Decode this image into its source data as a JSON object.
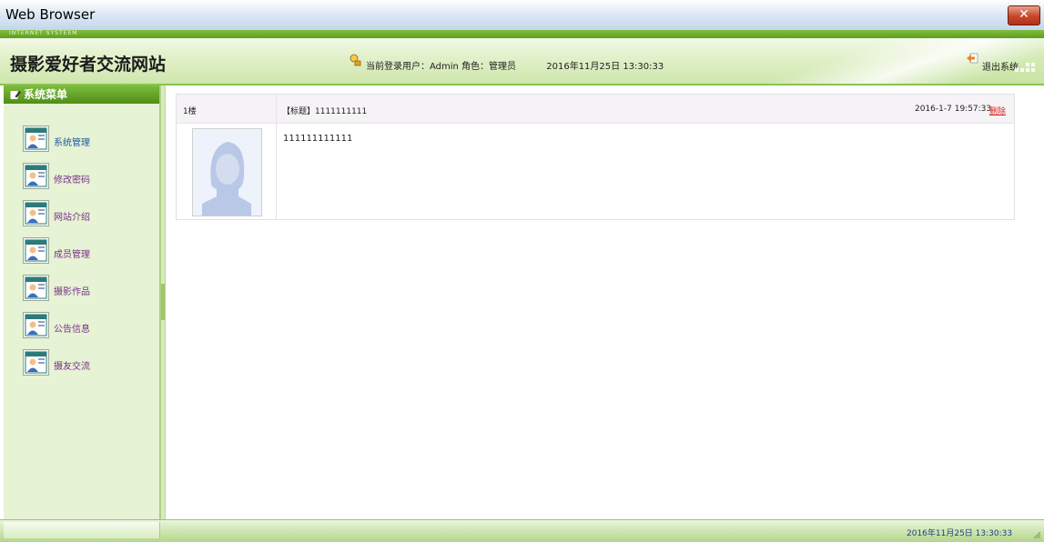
{
  "window": {
    "title": "Web Browser",
    "close_label": "✕"
  },
  "header": {
    "strip_text": "INTERNET SYSTEEM",
    "site_title": "摄影爱好者交流网站",
    "user_info": "当前登录用户：Admin 角色：管理员",
    "datetime": "2016年11月25日  13:30:33",
    "logout_label": "退出系统"
  },
  "sidebar": {
    "heading": "系统菜单",
    "items": [
      {
        "label": "系统管理"
      },
      {
        "label": "修改密码"
      },
      {
        "label": "网站介绍"
      },
      {
        "label": "成员管理"
      },
      {
        "label": "摄影作品"
      },
      {
        "label": "公告信息"
      },
      {
        "label": "摄友交流"
      }
    ]
  },
  "post": {
    "floor": "1楼",
    "title": "【标题】1111111111",
    "date": "2016-1-7 19:57:33",
    "delete_label": "删除",
    "content": "111111111111"
  },
  "footer": {
    "datetime": "2016年11月25日  13:30:33"
  },
  "colors": {
    "accent_green": "#5e9e1f",
    "sidebar_bg": "#e6f3d4",
    "delete_red": "#dd2222"
  }
}
